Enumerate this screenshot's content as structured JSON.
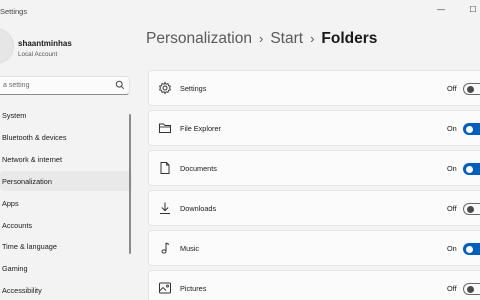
{
  "window": {
    "title": "Settings",
    "minimize_glyph": "—",
    "maximize_glyph": "☐"
  },
  "user": {
    "name": "shaantminhas",
    "account_type": "Local Account"
  },
  "search": {
    "placeholder": "a setting"
  },
  "nav": {
    "items": [
      {
        "label": "System",
        "active": false
      },
      {
        "label": "Bluetooth & devices",
        "active": false
      },
      {
        "label": "Network & internet",
        "active": false
      },
      {
        "label": "Personalization",
        "active": true
      },
      {
        "label": "Apps",
        "active": false
      },
      {
        "label": "Accounts",
        "active": false
      },
      {
        "label": "Time & language",
        "active": false
      },
      {
        "label": "Gaming",
        "active": false
      },
      {
        "label": "Accessibility",
        "active": false
      }
    ]
  },
  "breadcrumb": {
    "items": [
      "Personalization",
      "Start",
      "Folders"
    ],
    "separator": "›"
  },
  "folders": [
    {
      "label": "Settings",
      "icon": "gear-icon",
      "state": "Off",
      "on": false
    },
    {
      "label": "File Explorer",
      "icon": "folder-icon",
      "state": "On",
      "on": true
    },
    {
      "label": "Documents",
      "icon": "document-icon",
      "state": "On",
      "on": true
    },
    {
      "label": "Downloads",
      "icon": "download-icon",
      "state": "Off",
      "on": false
    },
    {
      "label": "Music",
      "icon": "music-icon",
      "state": "On",
      "on": true
    },
    {
      "label": "Pictures",
      "icon": "picture-icon",
      "state": "Off",
      "on": false
    }
  ],
  "colors": {
    "accent": "#005fb8",
    "background": "#f3f3f3",
    "card": "#fbfbfb",
    "nav_active": "#e9e9e9"
  }
}
